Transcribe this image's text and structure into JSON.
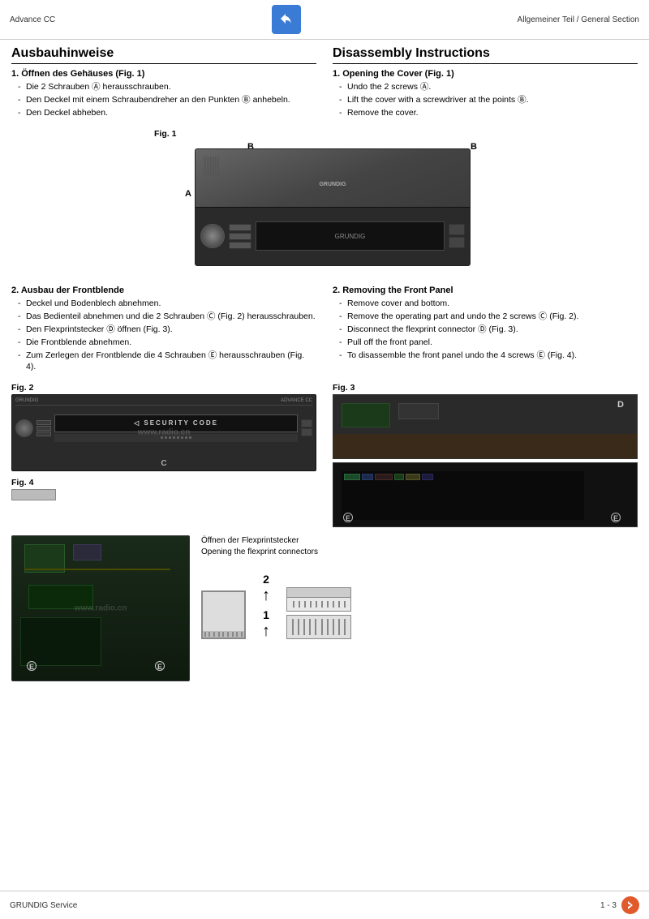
{
  "header": {
    "left": "Advance CC",
    "right": "Allgemeiner Teil / General Section",
    "icon_arrow": "↩"
  },
  "footer": {
    "left": "GRUNDIG Service",
    "right": "1 - 3",
    "icon": "→"
  },
  "left_column": {
    "title": "Ausbauhinweise",
    "section1_heading": "1. Öffnen des Gehäuses (Fig. 1)",
    "section1_items": [
      "Die 2 Schrauben Ⓐ herausschrauben.",
      "Den Deckel mit einem Schraubendreher an den Punkten Ⓑ anhebeln.",
      "Den Deckel abheben."
    ],
    "fig1_label": "Fig. 1",
    "label_A": "A",
    "label_B_left": "B",
    "label_B_right": "B",
    "section2_heading": "2. Ausbau der Frontblende",
    "section2_items": [
      "Deckel und Bodenblech abnehmen.",
      "Das Bedienteil abnehmen und die 2 Schrauben Ⓒ (Fig. 2) herausschrauben.",
      "Den Flexprintstecker Ⓓ öffnen (Fig. 3).",
      "Die Frontblende abnehmen.",
      "Zum Zerlegen der Frontblende die 4 Schrauben Ⓔ herausschrauben (Fig. 4)."
    ],
    "fig2_label": "Fig. 2",
    "fig4_label": "Fig. 4"
  },
  "right_column": {
    "title": "Disassembly Instructions",
    "section1_heading": "1. Opening the Cover (Fig. 1)",
    "section1_items": [
      "Undo the 2 screws Ⓐ.",
      "Lift the cover with a screwdriver at the points Ⓑ.",
      "Remove the cover."
    ],
    "section2_heading": "2. Removing the Front Panel",
    "section2_items": [
      "Remove cover and bottom.",
      "Remove the operating part and undo the 2 screws Ⓒ (Fig. 2).",
      "Disconnect the flexprint connector Ⓓ (Fig. 3).",
      "Pull off the front panel.",
      "To disassemble the front panel undo the 4 screws Ⓔ (Fig. 4)."
    ],
    "fig3_label": "Fig. 3",
    "label_D": "D"
  },
  "security_code": "◁ SECURITY CODE",
  "label_C": "C",
  "bottom": {
    "flexprint_title_de": "Öffnen der Flexprintstecker",
    "flexprint_title_en": "Opening the flexprint connectors",
    "number_2": "2",
    "number_1": "1"
  },
  "label_E_left": "E",
  "label_E_right": "E",
  "watermark": "www.radio.cn"
}
